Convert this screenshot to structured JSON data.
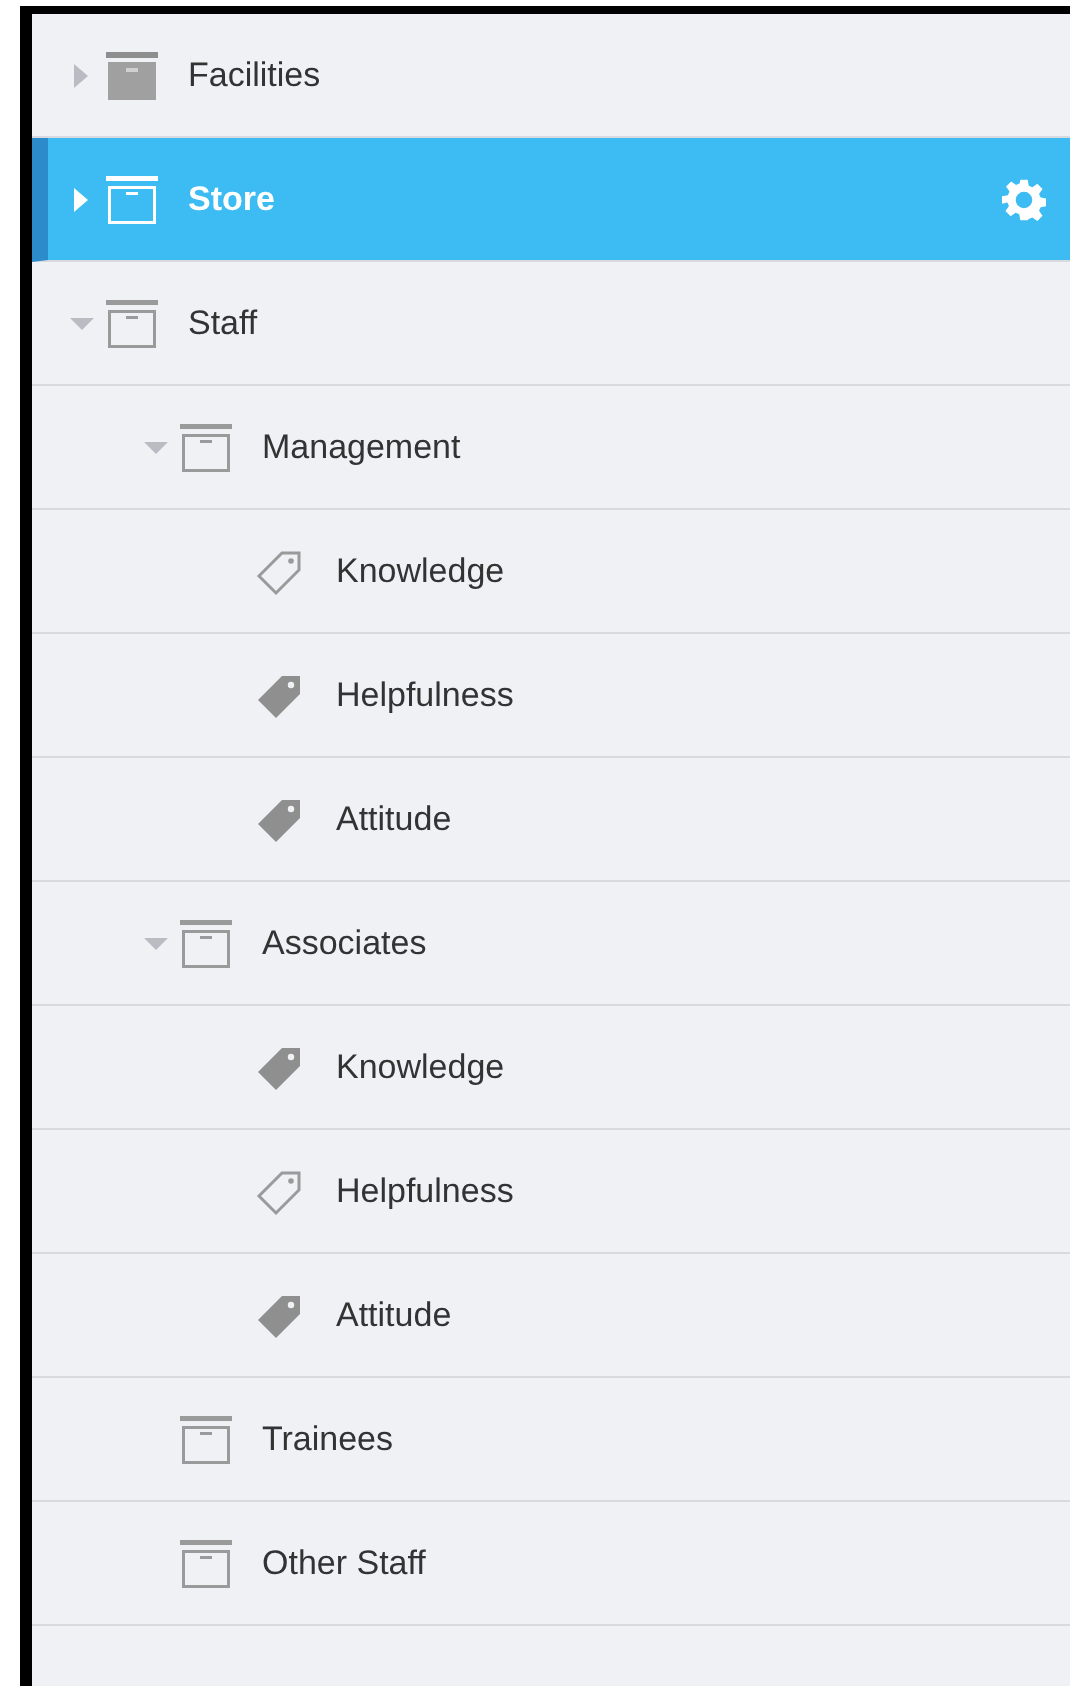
{
  "tree": [
    {
      "label": "Facilities",
      "kind": "folder",
      "filled": true,
      "expanded": false,
      "selected": false
    },
    {
      "label": "Store",
      "kind": "folder",
      "filled": false,
      "expanded": false,
      "selected": true
    },
    {
      "label": "Staff",
      "kind": "folder",
      "filled": false,
      "expanded": true,
      "selected": false,
      "children": [
        {
          "label": "Management",
          "kind": "folder",
          "filled": false,
          "expanded": true,
          "selected": false,
          "children": [
            {
              "label": "Knowledge",
              "kind": "tag",
              "filled": false,
              "selected": false
            },
            {
              "label": "Helpfulness",
              "kind": "tag",
              "filled": true,
              "selected": false
            },
            {
              "label": "Attitude",
              "kind": "tag",
              "filled": true,
              "selected": false
            }
          ]
        },
        {
          "label": "Associates",
          "kind": "folder",
          "filled": false,
          "expanded": true,
          "selected": false,
          "children": [
            {
              "label": "Knowledge",
              "kind": "tag",
              "filled": true,
              "selected": false
            },
            {
              "label": "Helpfulness",
              "kind": "tag",
              "filled": false,
              "selected": false
            },
            {
              "label": "Attitude",
              "kind": "tag",
              "filled": true,
              "selected": false
            }
          ]
        },
        {
          "label": "Trainees",
          "kind": "folder",
          "filled": false,
          "selected": false
        },
        {
          "label": "Other Staff",
          "kind": "folder",
          "filled": false,
          "selected": false
        }
      ]
    }
  ]
}
